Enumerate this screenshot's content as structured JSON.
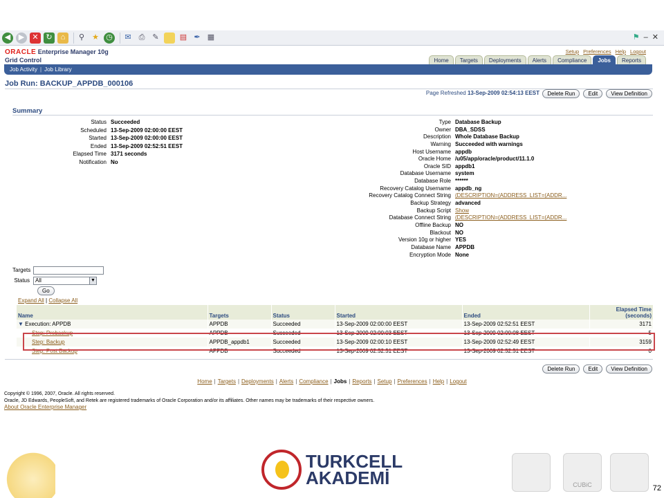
{
  "global_links": [
    "Setup",
    "Preferences",
    "Help",
    "Logout"
  ],
  "brand": {
    "oracle": "ORACLE",
    "product": "Enterprise Manager 10g",
    "subtitle": "Grid Control"
  },
  "tabs": [
    {
      "label": "Home",
      "active": false
    },
    {
      "label": "Targets",
      "active": false
    },
    {
      "label": "Deployments",
      "active": false
    },
    {
      "label": "Alerts",
      "active": false
    },
    {
      "label": "Compliance",
      "active": false
    },
    {
      "label": "Jobs",
      "active": true
    },
    {
      "label": "Reports",
      "active": false
    }
  ],
  "subnav": {
    "job_activity": "Job Activity",
    "separator": "|",
    "job_library": "Job Library"
  },
  "page": {
    "title": "Job Run: BACKUP_APPDB_000106",
    "refresh_label": "Page Refreshed",
    "refresh_time": "13-Sep-2009 02:54:13 EEST",
    "buttons": {
      "delete": "Delete Run",
      "edit": "Edit",
      "view": "View Definition"
    },
    "summary_title": "Summary"
  },
  "summary_left": [
    {
      "label": "Status",
      "value": "Succeeded"
    },
    {
      "label": "Scheduled",
      "value": "13-Sep-2009 02:00:00 EEST"
    },
    {
      "label": "Started",
      "value": "13-Sep-2009 02:00:00 EEST"
    },
    {
      "label": "Ended",
      "value": "13-Sep-2009 02:52:51 EEST"
    },
    {
      "label": "Elapsed Time",
      "value": "3171 seconds"
    },
    {
      "label": "Notification",
      "value": "No"
    }
  ],
  "summary_right": [
    {
      "label": "Type",
      "value": "Database Backup",
      "link": false
    },
    {
      "label": "Owner",
      "value": "DBA_SDSS",
      "link": false
    },
    {
      "label": "Description",
      "value": "Whole Database Backup",
      "link": false
    },
    {
      "label": "Warning",
      "value": "Succeeded with warnings",
      "link": false
    },
    {
      "label": "Host Username",
      "value": "appdb",
      "link": false
    },
    {
      "label": "Oracle Home",
      "value": "/u05/app/oracle/product/11.1.0",
      "link": false
    },
    {
      "label": "Oracle SID",
      "value": "appdb1",
      "link": false
    },
    {
      "label": "Database Username",
      "value": "system",
      "link": false
    },
    {
      "label": "Database Role",
      "value": "******",
      "link": false
    },
    {
      "label": "Recovery Catalog Username",
      "value": "appdb_ng",
      "link": false
    },
    {
      "label": "Recovery Catalog Connect String",
      "value": "(DESCRIPTION=(ADDRESS_LIST=(ADDR...",
      "link": true
    },
    {
      "label": "Backup Strategy",
      "value": "advanced",
      "link": false
    },
    {
      "label": "Backup Script",
      "value": "Show",
      "link": true
    },
    {
      "label": "Database Connect String",
      "value": "(DESCRIPTION=(ADDRESS_LIST=(ADDR...",
      "link": true
    },
    {
      "label": "Offline Backup",
      "value": "NO",
      "link": false
    },
    {
      "label": "Blackout",
      "value": "NO",
      "link": false
    },
    {
      "label": "Version 10g or higher",
      "value": "YES",
      "link": false
    },
    {
      "label": "Database Name",
      "value": "APPDB",
      "link": false
    },
    {
      "label": "Encryption Mode",
      "value": "None",
      "link": false
    }
  ],
  "filters": {
    "targets_label": "Targets",
    "targets_value": "",
    "status_label": "Status",
    "status_value": "All",
    "go": "Go"
  },
  "table": {
    "expand_all": "Expand All",
    "separator": "|",
    "collapse_all": "Collapse All",
    "headers": [
      "Name",
      "Targets",
      "Status",
      "Started",
      "Ended",
      "Elapsed Time (seconds)"
    ],
    "rows": [
      {
        "name": "Execution: APPDB",
        "targets": "APPDB",
        "status": "Succeeded",
        "started": "13-Sep-2009 02:00:00 EEST",
        "ended": "13-Sep-2009 02:52:51 EEST",
        "elapsed": "3171",
        "link": false
      },
      {
        "name": "Step: Prebackup",
        "targets": "APPDB",
        "status": "Succeeded",
        "started": "13-Sep-2009 02:00:03 EEST",
        "ended": "13-Sep-2009 02:00:08 EEST",
        "elapsed": "5",
        "link": true
      },
      {
        "name": "Step: Backup",
        "targets": "APPDB_appdb1",
        "status": "Succeeded",
        "started": "13-Sep-2009 02:00:10 EEST",
        "ended": "13-Sep-2009 02:52:49 EEST",
        "elapsed": "3159",
        "link": true
      },
      {
        "name": "Step: Post Backup",
        "targets": "APPDB",
        "status": "Succeeded",
        "started": "13-Sep-2009 02:52:51 EEST",
        "ended": "13-Sep-2009 02:52:51 EEST",
        "elapsed": "0",
        "link": true
      }
    ]
  },
  "footer": {
    "links": [
      "Home",
      "Targets",
      "Deployments",
      "Alerts",
      "Compliance",
      "Jobs",
      "Reports",
      "Setup",
      "Preferences",
      "Help",
      "Logout"
    ],
    "current": "Jobs",
    "copyright_1": "Copyright © 1996, 2007, Oracle. All rights reserved.",
    "copyright_2": "Oracle, JD Edwards, PeopleSoft, and Retek are registered trademarks of Oracle Corporation and/or its affiliates. Other names may be trademarks of their respective owners.",
    "about": "About Oracle Enterprise Manager"
  },
  "banner": {
    "logo_line1": "TURKCELL",
    "logo_line2": "AKADEMİ",
    "partner2": "CUBiC",
    "page_number": "72"
  },
  "colors": {
    "oracle_red": "#e0201b",
    "nav_blue": "#3b5f9a",
    "highlight": "#c9454a",
    "link": "#8a5c1a"
  }
}
